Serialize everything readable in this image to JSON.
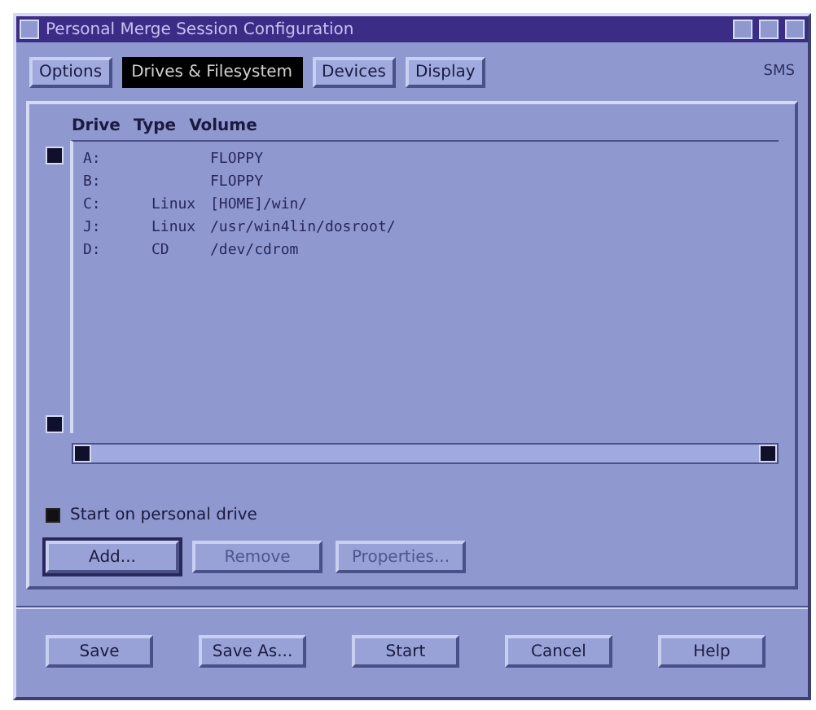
{
  "window": {
    "title": "Personal Merge Session Configuration"
  },
  "tabs": [
    {
      "label": "Options",
      "selected": false
    },
    {
      "label": "Drives & Filesystem",
      "selected": true
    },
    {
      "label": "Devices",
      "selected": false
    },
    {
      "label": "Display",
      "selected": false
    }
  ],
  "tab_bar_note": "SMS",
  "drive_list": {
    "columns": [
      "Drive",
      "Type",
      "Volume"
    ],
    "rows": [
      {
        "drive": "A:",
        "type": "",
        "volume": "FLOPPY"
      },
      {
        "drive": "B:",
        "type": "",
        "volume": "FLOPPY"
      },
      {
        "drive": "C:",
        "type": "Linux",
        "volume": "[HOME]/win/"
      },
      {
        "drive": "J:",
        "type": "Linux",
        "volume": "/usr/win4lin/dosroot/"
      },
      {
        "drive": "D:",
        "type": "CD",
        "volume": "/dev/cdrom"
      }
    ]
  },
  "start_on_personal_drive": {
    "label": "Start on personal drive",
    "checked": true
  },
  "list_buttons": [
    {
      "label": "Add...",
      "disabled": false
    },
    {
      "label": "Remove",
      "disabled": true
    },
    {
      "label": "Properties...",
      "disabled": true
    }
  ],
  "dialog_buttons": [
    "Save",
    "Save As...",
    "Start",
    "Cancel",
    "Help"
  ]
}
